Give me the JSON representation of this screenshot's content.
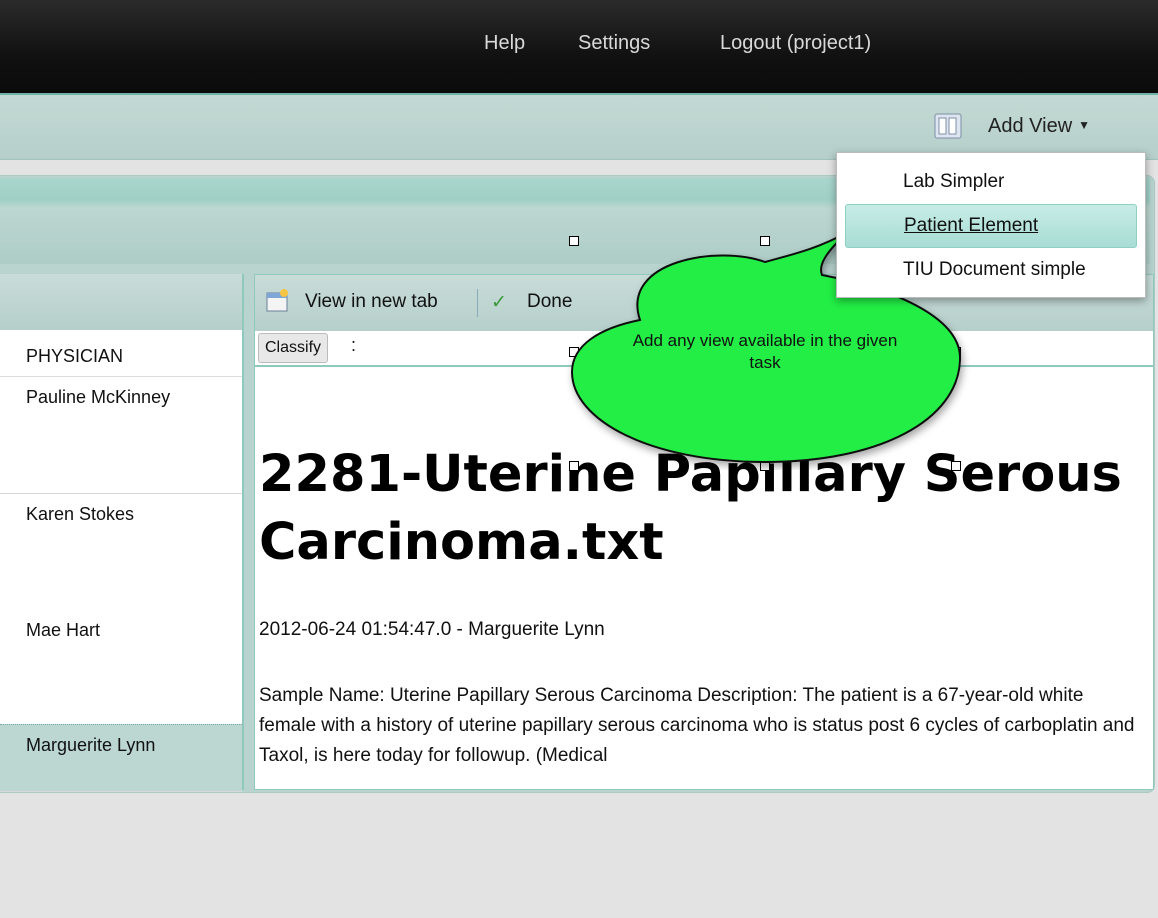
{
  "topbar": {
    "help": "Help",
    "settings": "Settings",
    "logout": "Logout (project1)"
  },
  "toolbar": {
    "layout_icon": "layout-columns-icon",
    "add_view_label": "Add View"
  },
  "add_view_menu": {
    "items": [
      {
        "label": "Lab Simpler",
        "active": false
      },
      {
        "label": "Patient Element",
        "active": true
      },
      {
        "label": "TIU Document simple",
        "active": false
      }
    ]
  },
  "patient_list": {
    "column_header": "PHYSICIAN",
    "rows": [
      {
        "physician": "Pauline McKinney",
        "selected": false
      },
      {
        "physician": "Karen Stokes",
        "selected": false
      },
      {
        "physician": "Mae Hart",
        "selected": false
      },
      {
        "physician": "Marguerite Lynn",
        "selected": true
      }
    ]
  },
  "document": {
    "view_new_tab_label": "View in new tab",
    "done_label": "Done",
    "classify_label": "Classify",
    "classify_value": ":",
    "title": "2281-Uterine Papillary Serous Carcinoma.txt",
    "meta": "2012-06-24 01:54:47.0 - Marguerite Lynn",
    "body": "Sample Name: Uterine Papillary Serous Carcinoma Description: The patient is a 67-year-old white female with a history of uterine papillary serous carcinoma who is status post 6 cycles of carboplatin and Taxol, is here today for followup. (Medical"
  },
  "callout": {
    "text": "Add any view available in the given task",
    "fill": "#22ee44"
  },
  "colors": {
    "topbar": "#111111",
    "toolbar": "#b6cfca",
    "accent": "#8fc9bd",
    "selected_row": "#bcd7d2"
  }
}
